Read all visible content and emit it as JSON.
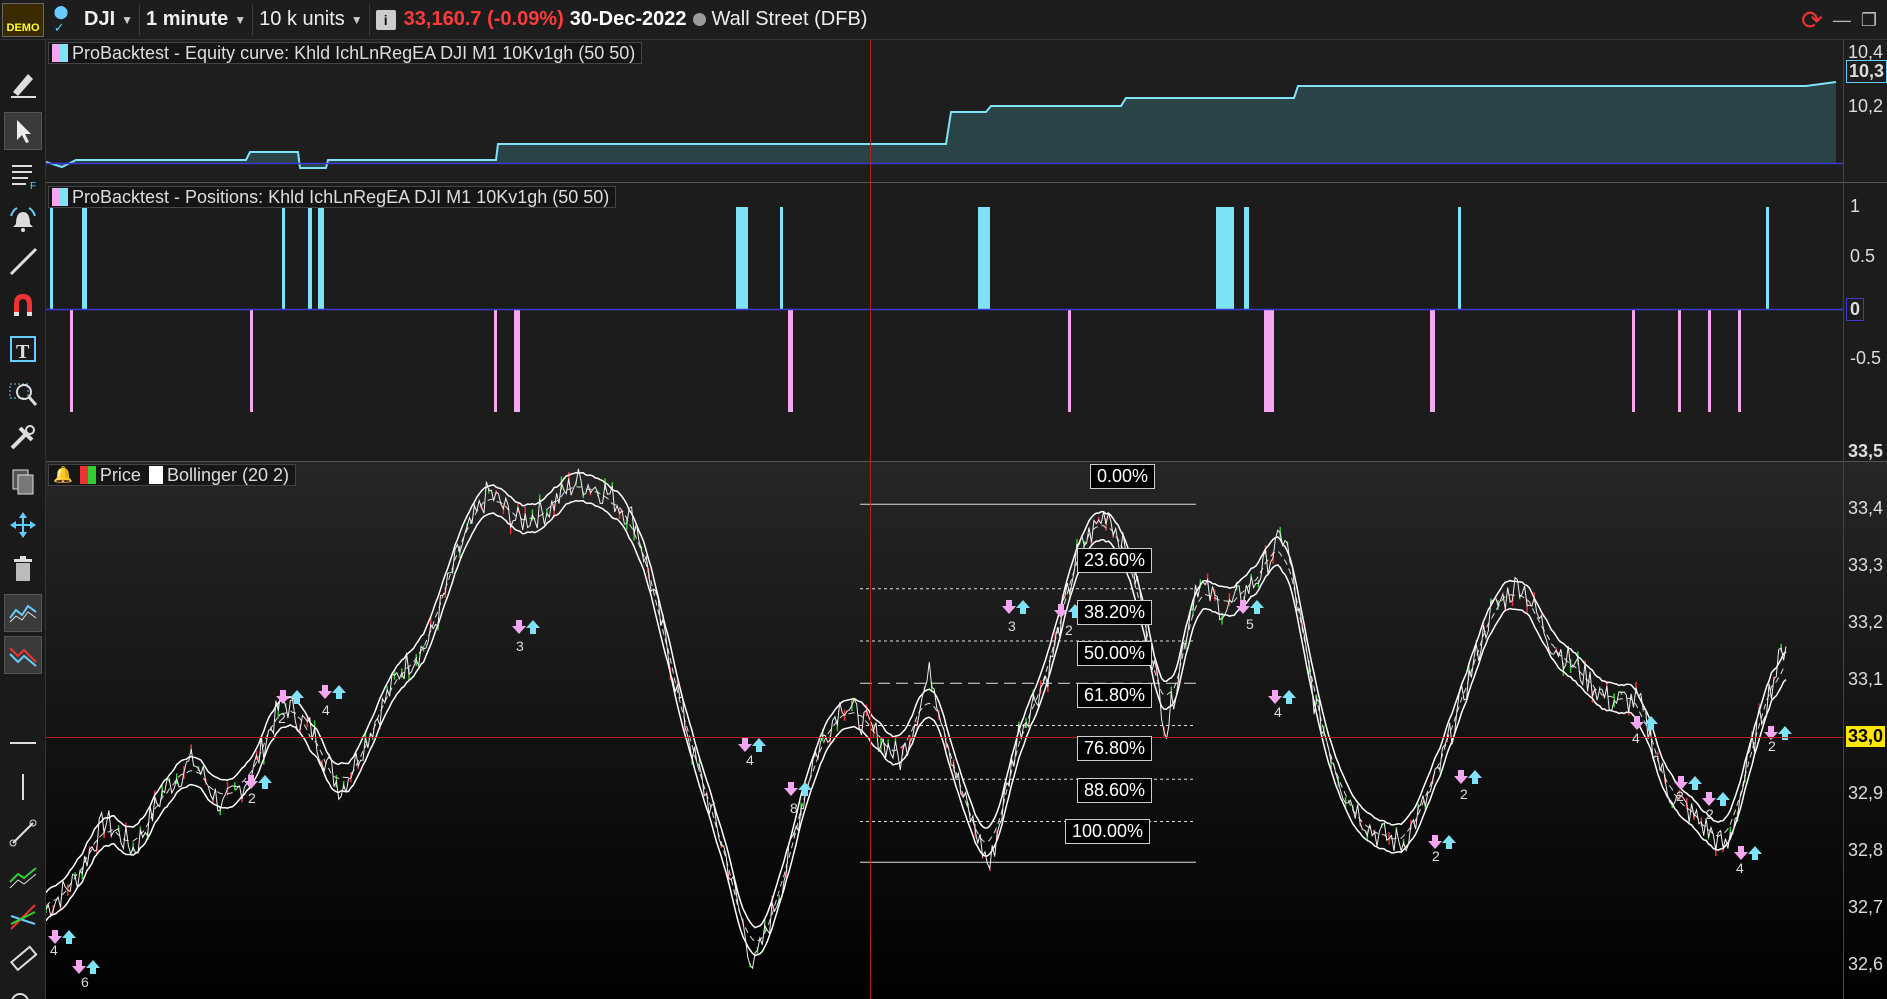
{
  "app": {
    "demo_label": "DEMO",
    "instrument": "DJI",
    "timeframe": "1 minute",
    "units": "10 k units",
    "info_icon_glyph": "i",
    "price_change": "33,160.7 (-0.09%)",
    "date": "30-Dec-2022",
    "exchange": "Wall Street (DFB)"
  },
  "panels": {
    "equity": {
      "legend": "ProBacktest - Equity curve: Khld IchLnRegEA DJI M1 10Kv1gh (50 50)",
      "axis": [
        "10,4",
        "10,3",
        "10,2"
      ]
    },
    "positions": {
      "legend": "ProBacktest - Positions: Khld IchLnRegEA DJI M1 10Kv1gh (50 50)",
      "axis": [
        "1",
        "0.5",
        "0",
        "-0.5"
      ]
    },
    "price": {
      "legend_price": "Price",
      "legend_bollinger": "Bollinger (20 2)",
      "axis": [
        "33,5",
        "33,4",
        "33,3",
        "33,2",
        "33,1",
        "33,0",
        "32,9",
        "32,8",
        "32,7",
        "32,6"
      ],
      "current_price_label": "33,0"
    }
  },
  "fibonacci": [
    "0.00%",
    "23.60%",
    "38.20%",
    "50.00%",
    "61.80%",
    "76.80%",
    "88.60%",
    "100.00%"
  ],
  "trade_counts": [
    "4",
    "6",
    "2",
    "2",
    "4",
    "3",
    "4",
    "8",
    "3",
    "2",
    "5",
    "4",
    "2",
    "2",
    "4",
    "2",
    "2",
    "4",
    "2"
  ],
  "colors": {
    "equity_line": "#7fe3f5",
    "long_bar": "#7ee3f7",
    "short_bar": "#f4a6f0",
    "price_red": "#ff3b3b",
    "highlight": "#ffe600"
  },
  "chart_data": {
    "type": "line",
    "title": "",
    "series": [
      {
        "values": [
          32.75,
          32.8,
          32.9,
          32.85,
          32.95,
          33.0,
          32.92,
          32.98,
          33.1,
          33.05,
          32.95,
          33.05,
          33.15,
          33.2,
          33.35,
          33.45,
          33.4,
          33.42,
          33.47,
          33.45,
          33.4,
          33.2,
          33.0,
          32.85,
          32.65,
          32.8,
          33.0,
          33.1,
          33.05,
          33.0,
          33.15,
          32.95,
          32.82,
          33.05,
          33.15,
          33.35,
          33.42,
          33.3,
          33.05,
          33.3,
          33.25,
          33.3,
          33.38,
          33.1,
          32.95,
          32.88,
          32.86,
          32.95,
          33.1,
          33.25,
          33.3,
          33.2,
          33.15,
          33.1,
          33.1,
          32.95,
          32.9,
          32.85,
          33.05,
          33.2
        ]
      }
    ],
    "ylim": [
      32.6,
      33.5
    ],
    "fib_range": [
      32.83,
      33.43
    ]
  }
}
